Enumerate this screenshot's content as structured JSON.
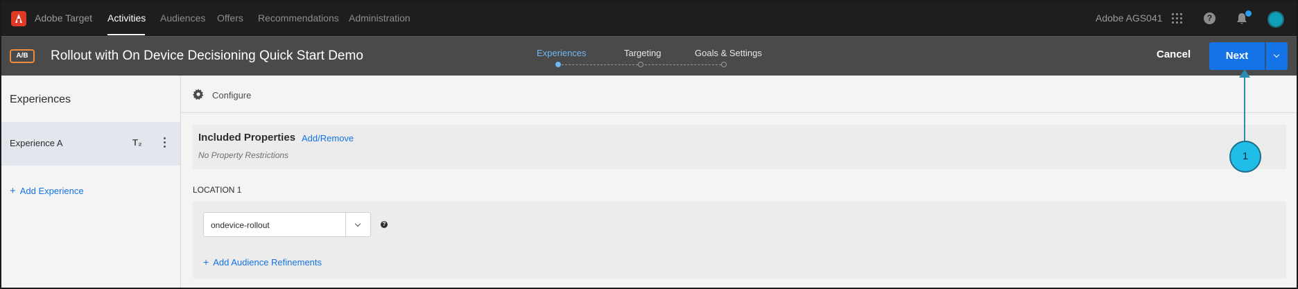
{
  "topnav": {
    "brand": "Adobe Target",
    "items": [
      {
        "label": "Activities",
        "active": true
      },
      {
        "label": "Audiences",
        "active": false
      },
      {
        "label": "Offers",
        "active": false
      },
      {
        "label": "Recommendations",
        "active": false
      },
      {
        "label": "Administration",
        "active": false
      }
    ],
    "org": "Adobe AGS041",
    "icons": [
      "apps-grid-icon",
      "help-icon",
      "bell-icon",
      "avatar"
    ]
  },
  "activity": {
    "badge": "A/B",
    "title": "Rollout with On Device Decisioning Quick Start Demo",
    "steps": [
      {
        "label": "Experiences",
        "active": true
      },
      {
        "label": "Targeting",
        "active": false
      },
      {
        "label": "Goals & Settings",
        "active": false
      }
    ],
    "cancel": "Cancel",
    "next": "Next"
  },
  "sidebar": {
    "title": "Experiences",
    "experiences": [
      {
        "label": "Experience A"
      }
    ],
    "add_experience": "Add Experience"
  },
  "main": {
    "configure": "Configure",
    "properties": {
      "title": "Included Properties",
      "link": "Add/Remove",
      "note": "No Property Restrictions"
    },
    "location": {
      "label": "LOCATION 1",
      "value": "ondevice-rollout",
      "add_refinements": "Add Audience Refinements"
    }
  },
  "callout": {
    "number": "1"
  },
  "colors": {
    "accent": "#1473e6",
    "topnav_bg": "#1e1e1e",
    "actbar_bg": "#4a4a4a",
    "callout": "#1fbde8"
  }
}
